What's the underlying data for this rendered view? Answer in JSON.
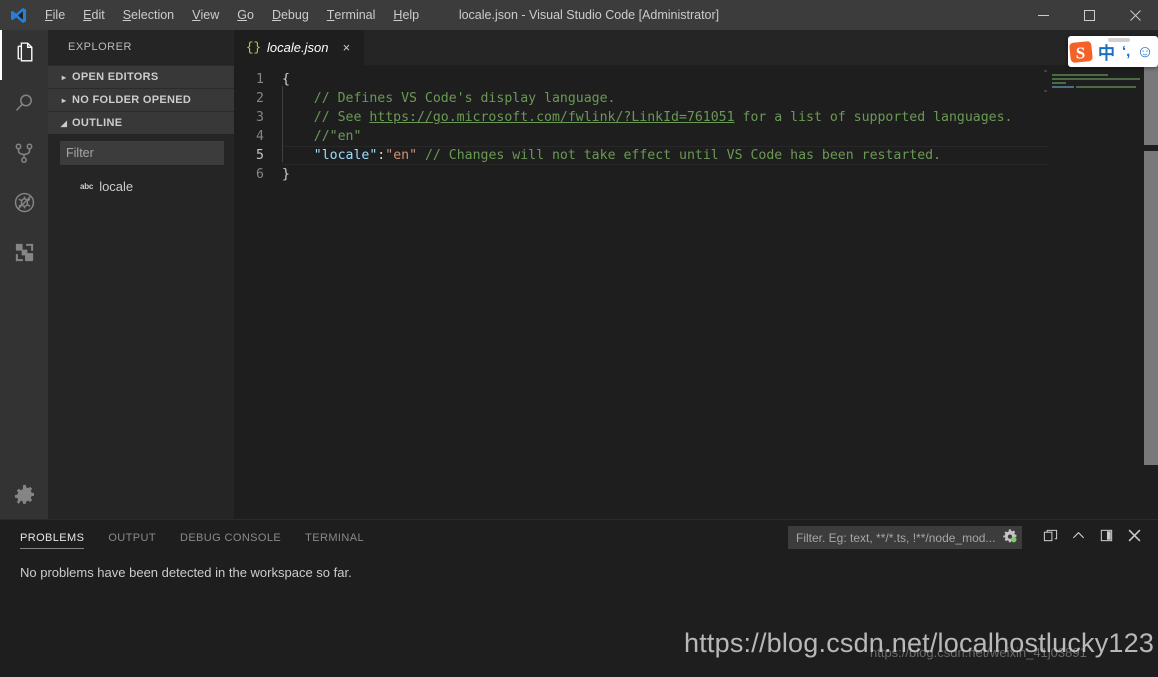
{
  "window": {
    "title": "locale.json - Visual Studio Code [Administrator]",
    "logo_icon": "vscode-logo-icon",
    "minimize_icon": "minimize-icon",
    "maximize_icon": "maximize-icon",
    "close_icon": "close-icon"
  },
  "menu": {
    "items": [
      {
        "label": "File",
        "mnemonic": "F",
        "rest": "ile"
      },
      {
        "label": "Edit",
        "mnemonic": "E",
        "rest": "dit"
      },
      {
        "label": "Selection",
        "mnemonic": "S",
        "rest": "election"
      },
      {
        "label": "View",
        "mnemonic": "V",
        "rest": "iew"
      },
      {
        "label": "Go",
        "mnemonic": "G",
        "rest": "o"
      },
      {
        "label": "Debug",
        "mnemonic": "D",
        "rest": "ebug"
      },
      {
        "label": "Terminal",
        "mnemonic": "T",
        "rest": "erminal"
      },
      {
        "label": "Help",
        "mnemonic": "H",
        "rest": "elp"
      }
    ]
  },
  "activitybar": {
    "items": [
      {
        "name": "explorer",
        "icon": "files-icon",
        "active": true
      },
      {
        "name": "search",
        "icon": "search-icon",
        "active": false
      },
      {
        "name": "source-control",
        "icon": "source-control-icon",
        "active": false
      },
      {
        "name": "debug",
        "icon": "debug-no-icon",
        "active": false
      },
      {
        "name": "extensions",
        "icon": "extensions-icon",
        "active": false
      }
    ],
    "manage_icon": "gear-icon"
  },
  "sidebar": {
    "title": "EXPLORER",
    "sections": [
      {
        "label": "OPEN EDITORS",
        "expanded": false,
        "twisty": "▸"
      },
      {
        "label": "NO FOLDER OPENED",
        "expanded": false,
        "twisty": "▸"
      },
      {
        "label": "OUTLINE",
        "expanded": true,
        "twisty": "◢"
      }
    ],
    "filter_placeholder": "Filter",
    "outline_items": [
      {
        "kind_icon": "abc",
        "label": "locale"
      }
    ]
  },
  "editor": {
    "tab": {
      "icon": "json-braces-icon",
      "icon_text": "{}",
      "label": "locale.json",
      "close_icon": "×"
    },
    "lines": [
      {
        "number": "1"
      },
      {
        "number": "2"
      },
      {
        "number": "3"
      },
      {
        "number": "4"
      },
      {
        "number": "5"
      },
      {
        "number": "6"
      }
    ],
    "current_line": 5,
    "code": {
      "l1_brace_open": "{",
      "l2_comment": "// Defines VS Code's display language.",
      "l3_comment_pre": "// See ",
      "l3_link": "https://go.microsoft.com/fwlink/?LinkId=761051",
      "l3_comment_post": " for a list of supported languages.",
      "l4_comment": "//\"en\"",
      "l5_key": "\"locale\"",
      "l5_colon": ":",
      "l5_value": "\"en\"",
      "l5_comment": " // Changes will not take effect until VS Code has been restarted.",
      "l6_brace_close": "}"
    },
    "colors": {
      "background": "#1e1e1e",
      "comment": "#6a9955",
      "key": "#9cdcfe",
      "string": "#ce9178",
      "punctuation": "#d4d4d4",
      "line_number": "#858585"
    }
  },
  "panel": {
    "tabs": [
      {
        "label": "PROBLEMS",
        "active": true
      },
      {
        "label": "OUTPUT",
        "active": false
      },
      {
        "label": "DEBUG CONSOLE",
        "active": false
      },
      {
        "label": "TERMINAL",
        "active": false
      }
    ],
    "filter_placeholder": "Filter. Eg: text, **/*.ts, !**/node_mod...",
    "filter_icon": "filter-settings-gear-icon",
    "actions": [
      {
        "name": "split-panel",
        "icon": "split-editor-icon"
      },
      {
        "name": "maximize-panel",
        "icon": "chevron-up-icon"
      },
      {
        "name": "toggle-panel-position",
        "icon": "layout-panel-icon"
      },
      {
        "name": "close-panel",
        "icon": "close-icon"
      }
    ],
    "message": "No problems have been detected in the workspace so far."
  },
  "ime": {
    "logo": "S",
    "language_toggle": "中",
    "punctuation_toggle": "‘,",
    "emoji_button": "☺"
  },
  "watermark": {
    "primary": "https://blog.csdn.net/localhostlucky123",
    "secondary": "https://blog.csdn.net/weixin_41j03891"
  }
}
